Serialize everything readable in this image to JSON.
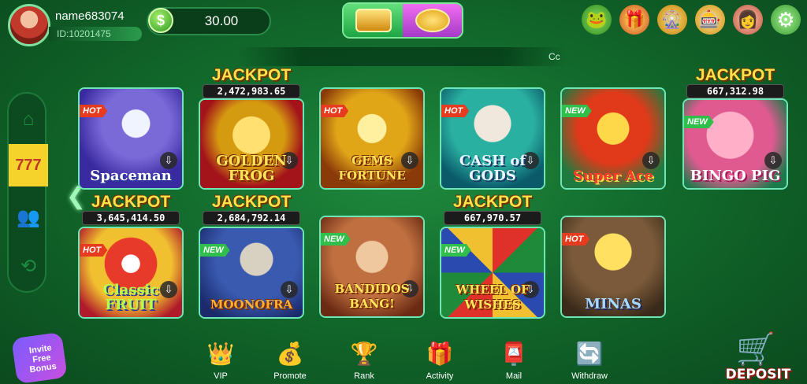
{
  "user": {
    "name": "name683074",
    "id": "ID:10201475"
  },
  "wallet": {
    "currency_symbol": "$",
    "balance": "30.00"
  },
  "marquee": {
    "text": "Cc"
  },
  "top_icons": [
    "frog-mascot-icon",
    "gift-box-icon",
    "wheel-icon",
    "lucky-box-icon",
    "support-agent-icon",
    "gear-icon"
  ],
  "sidebar": {
    "active_label": "777"
  },
  "games": [
    {
      "title": "Spaceman",
      "badge": "HOT",
      "jackpot": null
    },
    {
      "title": "GOLDEN FROG",
      "badge": "",
      "jackpot": "2,472,983.65"
    },
    {
      "title": "GEMS FORTUNE",
      "badge": "HOT",
      "jackpot": null
    },
    {
      "title": "CASH of GODS",
      "badge": "HOT",
      "jackpot": null
    },
    {
      "title": "Super Ace",
      "badge": "NEW",
      "jackpot": null
    },
    {
      "title": "BINGO PIG",
      "badge": "NEW",
      "jackpot": "667,312.98"
    },
    {
      "title": "Classic FRUIT",
      "badge": "HOT",
      "jackpot": "3,645,414.50"
    },
    {
      "title": "MOONOFRA",
      "badge": "NEW",
      "jackpot": "2,684,792.14"
    },
    {
      "title": "BANDIDOS BANG!",
      "badge": "NEW",
      "jackpot": null
    },
    {
      "title": "WHEEL OF WISHES",
      "badge": "NEW",
      "jackpot": "667,970.57"
    },
    {
      "title": "MINAS",
      "badge": "HOT",
      "jackpot": null
    }
  ],
  "jackpot_label": "JACKPOT",
  "invite": {
    "text": "Invite Free Bonus"
  },
  "bottom_nav": [
    {
      "label": "VIP"
    },
    {
      "label": "Promote"
    },
    {
      "label": "Rank"
    },
    {
      "label": "Activity"
    },
    {
      "label": "Mail"
    },
    {
      "label": "Withdraw"
    }
  ],
  "deposit": {
    "label": "DEPOSIT"
  }
}
